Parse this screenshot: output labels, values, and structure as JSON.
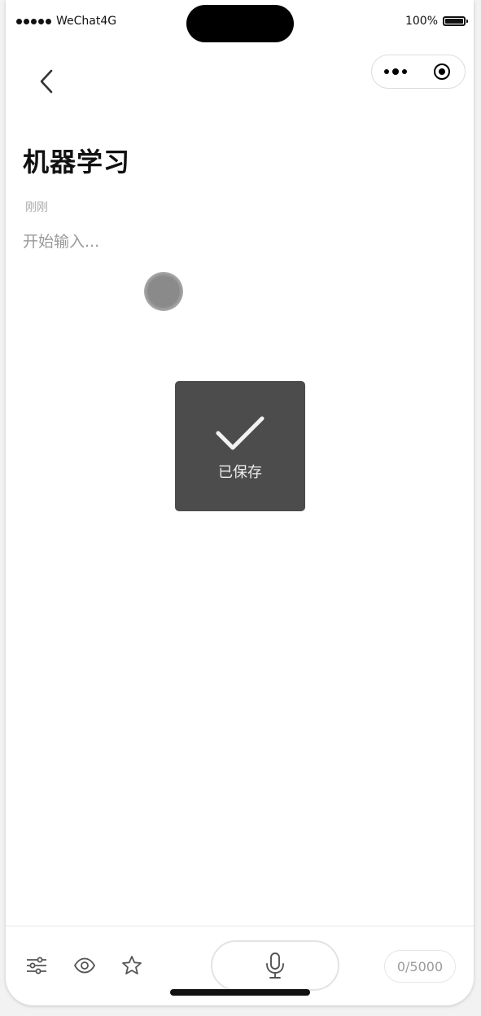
{
  "status_bar": {
    "carrier": "WeChat4G",
    "battery_percent": "100%"
  },
  "note": {
    "title": "机器学习",
    "timestamp": "刚刚",
    "body_placeholder": "开始输入...",
    "body_value": ""
  },
  "toast": {
    "label": "已保存",
    "icon": "checkmark-icon"
  },
  "bottom_bar": {
    "tools": [
      "sliders-icon",
      "eye-icon",
      "star-icon"
    ],
    "mic_icon": "microphone-icon",
    "char_count": "0/5000"
  },
  "colors": {
    "toast_bg": "#4c4c4c",
    "timestamp": "#aaaaaa",
    "placeholder": "#9a9a9a"
  }
}
